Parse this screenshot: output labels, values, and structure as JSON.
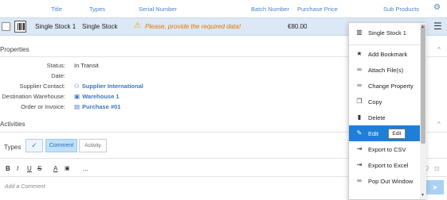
{
  "header": {
    "title": "Title",
    "types": "Types",
    "serial_number": "Serial Number",
    "batch_number": "Batch Number",
    "purchase_price": "Purchase Price",
    "sub_products": "Sub Products",
    "settings_icon": "gear-icon"
  },
  "row": {
    "title": "Single Stock 1",
    "type": "Single Stock",
    "warning": "Please, provide the required data!",
    "price": "€80.00"
  },
  "properties": {
    "section_title": "Properties",
    "fields": [
      {
        "label": "Status:",
        "value": "In Transit"
      },
      {
        "label": "Date:",
        "value": ""
      },
      {
        "label": "Supplier Contact:",
        "value": "Supplier International"
      },
      {
        "label": "Destination Warehouse:",
        "value": "Warehouse 1"
      },
      {
        "label": "Order or Invoice:",
        "value": "Purchase #01"
      }
    ]
  },
  "activities": {
    "section_title": "Activities",
    "types_label": "Types",
    "comment_label": "Comment",
    "activity_label": "Activity",
    "add_comment_placeholder": "Add a Comment",
    "ellipsis": "..."
  },
  "context_menu": {
    "header": "Single Stock 1",
    "items": [
      {
        "label": "Add Bookmark",
        "icon": "star-icon"
      },
      {
        "label": "Attach File(s)",
        "icon": "link-icon"
      },
      {
        "label": "Change Property",
        "icon": "link-icon"
      },
      {
        "label": "Copy",
        "icon": "copy-icon"
      },
      {
        "label": "Delete",
        "icon": "trash-icon"
      },
      {
        "label": "Edit",
        "icon": "pencil-icon"
      },
      {
        "label": "Export to CSV",
        "icon": "export-icon"
      },
      {
        "label": "Export to Excel",
        "icon": "export-icon"
      },
      {
        "label": "Pop Out Window",
        "icon": "link-icon"
      }
    ],
    "tooltip": "Edit"
  },
  "colors": {
    "accent": "#1f7fd6",
    "row_highlight": "#dde8f6",
    "warning": "#e07b00",
    "link": "#3a77c2"
  }
}
